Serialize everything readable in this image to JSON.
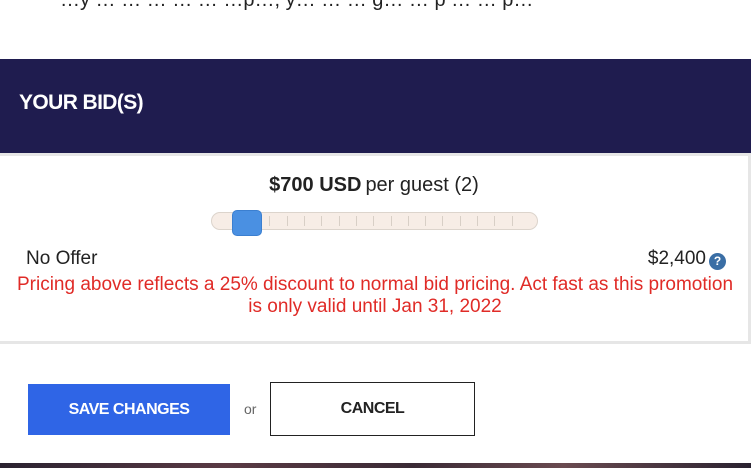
{
  "top": {
    "partial_text": "…y … … … … … …p…, y… … … g… … p … … p…"
  },
  "bid_section": {
    "title": "YOUR BID(S)"
  },
  "bid": {
    "amount": "$700 USD",
    "per_guest": "per guest (2)",
    "slider_min_label": "No Offer",
    "slider_max_label": "$2,400",
    "slider_value_fraction": 0.12,
    "slider_tick_count": 16,
    "help_icon_glyph": "?",
    "promo_text": "Pricing above reflects a 25% discount to normal bid pricing. Act fast as this promotion is only valid until Jan 31, 2022"
  },
  "actions": {
    "save_label": "SAVE CHANGES",
    "or_label": "or",
    "cancel_label": "CANCEL"
  },
  "colors": {
    "header_bg": "#1f1c4f",
    "save_button": "#2f65e6",
    "slider_thumb": "#4a90e2",
    "promo_text": "#e02b27",
    "help_icon": "#3a6ea5"
  }
}
